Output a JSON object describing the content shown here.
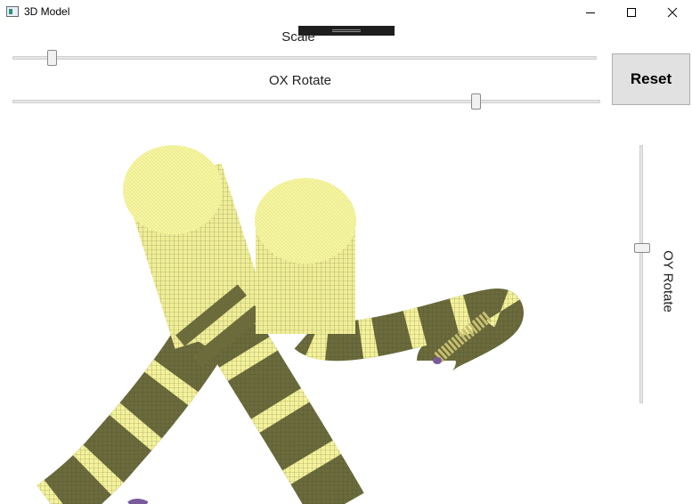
{
  "window": {
    "title": "3D Model",
    "icon": "app-window-icon",
    "controls": [
      "minimize-icon",
      "maximize-icon",
      "close-icon"
    ]
  },
  "controls": {
    "scale": {
      "label": "Scale",
      "value_fraction": 0.06
    },
    "ox_rotate": {
      "label": "OX Rotate",
      "value_fraction": 0.79
    },
    "oy_rotate": {
      "label": "OY Rotate",
      "value_fraction": 0.39
    },
    "reset_label": "Reset"
  },
  "colors": {
    "tube_light": "#f4f29a",
    "tube_dark": "#6b6b3c",
    "mesh_line": "#3a3a28",
    "tube_end": "#7a5a9a"
  }
}
